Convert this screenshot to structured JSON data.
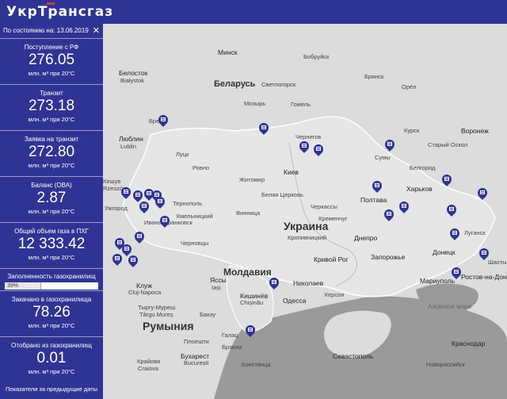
{
  "header": {
    "logo_text": "УкрТрансгаз"
  },
  "panel": {
    "as_of": "По состоянию на: 13.06.2019",
    "stats": [
      {
        "label": "Поступление с РФ",
        "value": "276.05",
        "unit": "млн. м³ при 20°С"
      },
      {
        "label": "Транзит",
        "value": "273.18",
        "unit": "млн. м³ при 20°С"
      },
      {
        "label": "Заявка на транзит",
        "value": "272.80",
        "unit": "млн. м³ при 20°С"
      },
      {
        "label": "Баланс (ОВА)",
        "value": "2.87",
        "unit": "млн. м³ при 20°С"
      },
      {
        "label": "Общий объем газа в ПХГ",
        "value": "12 333.42",
        "unit": "млн. м³ при 20°С"
      }
    ],
    "fill_label": "Заполненность газохранилищ",
    "fill_percent": "39%",
    "fill_fraction": 0.39,
    "stats2": [
      {
        "label": "Закачано в газохранилища",
        "value": "78.26",
        "unit": "млн. м³ при 20°С"
      },
      {
        "label": "Отобрано из газохранилищ",
        "value": "0.01",
        "unit": "млн. м³ при 20°С"
      }
    ],
    "footer": "Показатели за предыдущие даты"
  },
  "map": {
    "countries": [
      {
        "name": "Беларусь"
      },
      {
        "name": "Украина"
      },
      {
        "name": "Молдавия"
      },
      {
        "name": "Румыния"
      }
    ],
    "cities": [
      "Минск",
      "Белосток",
      "Białystok",
      "Брест",
      "Люблин",
      "Lublin",
      "Кешув",
      "Rzeszów",
      "Ровно",
      "Житомир",
      "Киев",
      "Белая Церковь",
      "Тернополь",
      "Хмельницкий",
      "Винница",
      "Ивано-Франковск",
      "Черновцы",
      "Черкассы",
      "Кременчуг",
      "Полтава",
      "Харьков",
      "Сумы",
      "Чернигов",
      "Гомель",
      "Мозырь",
      "Бобруйск",
      "Светлогорск",
      "Курск",
      "Воронеж",
      "Белгород",
      "Старый Оскол",
      "Днепро",
      "Запорожье",
      "Кривой Рог",
      "Кропивницкий",
      "Донецк",
      "Луганск",
      "Шахты",
      "Мариуполь",
      "Ростов-на-Дону",
      "Николаев",
      "Херсон",
      "Одесса",
      "Кишинёв",
      "Chișinău",
      "Яссы",
      "Iași",
      "Клуж",
      "Cluj-Napoca",
      "Тыргу-Муреш",
      "Târgu Mureș",
      "Бакэу",
      "Галац",
      "Брэила",
      "Бухарест",
      "București",
      "Констанца",
      "Крайова",
      "Craiova",
      "Плоешти",
      "Севастополь",
      "Краснодар",
      "Новороссийск",
      "Орёл",
      "Брянск",
      "Луцк",
      "Ужгород"
    ],
    "seas": [
      "Азовское море"
    ]
  }
}
